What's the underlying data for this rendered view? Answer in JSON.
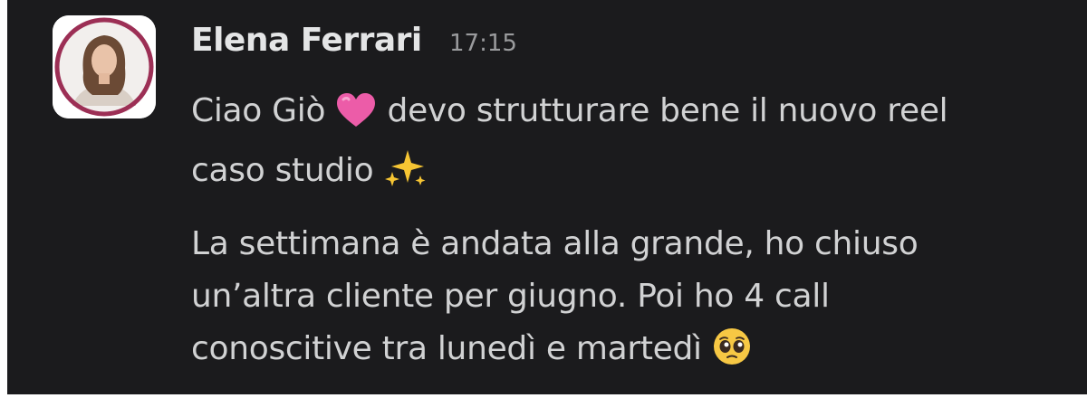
{
  "message": {
    "sender": "Elena Ferrari",
    "time": "17:15",
    "paragraph1": {
      "line1_before": "Ciao Giò",
      "emoji_heart": "pink-heart",
      "line1_after": "devo strutturare bene il nuovo reel",
      "line2": "caso studio",
      "emoji_sparkles": "sparkles"
    },
    "paragraph2": {
      "line1": "La settimana è andata alla grande, ho chiuso",
      "line2": "un’altra cliente per giugno. Poi ho 4 call",
      "line3": "conoscitive tra lunedì e martedì",
      "emoji_face": "pleading-face"
    }
  },
  "colors": {
    "background": "#1b1b1d",
    "text": "#d1d2d3",
    "timestamp": "#9a9b9d",
    "avatar_ring": "#9c2f55"
  }
}
